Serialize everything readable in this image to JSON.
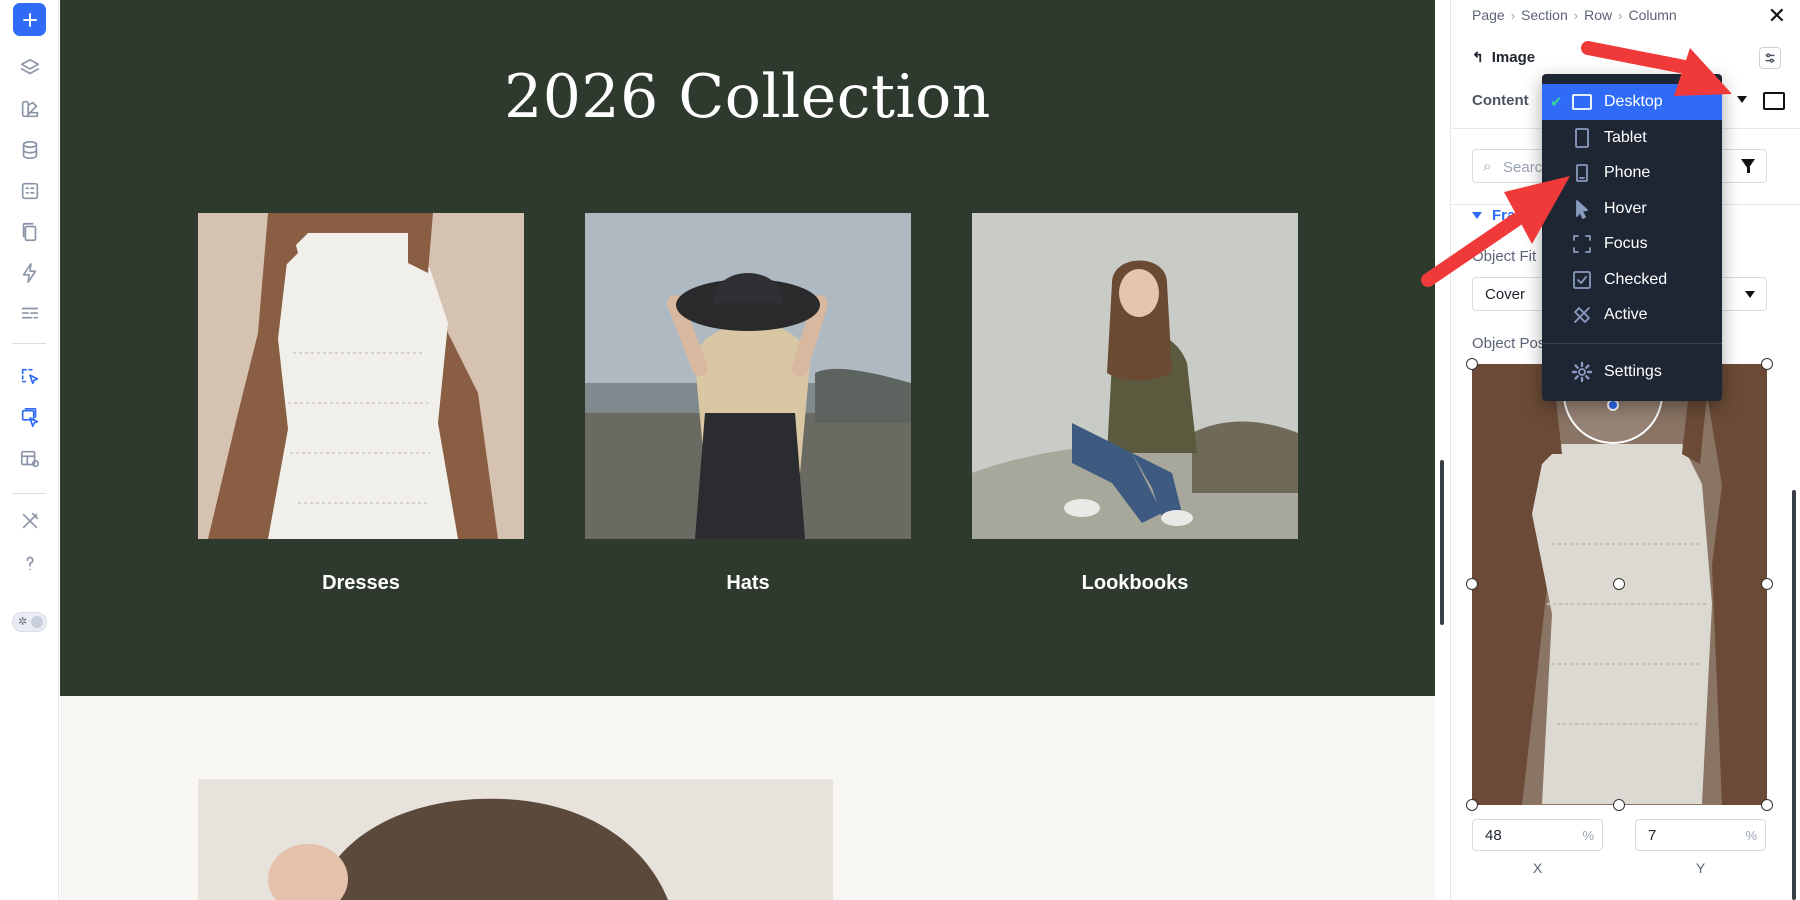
{
  "hero": {
    "title": "2026 Collection",
    "cards": [
      {
        "label": "Dresses"
      },
      {
        "label": "Hats"
      },
      {
        "label": "Lookbooks"
      }
    ]
  },
  "panel": {
    "breadcrumb": [
      "Page",
      "Section",
      "Row",
      "Column"
    ],
    "element_title": "Image",
    "content_tab": "Content",
    "search_placeholder": "Search",
    "section_title": "Frame",
    "object_fit_label": "Object Fit",
    "object_fit_value": "Cover",
    "object_position_label": "Object Position",
    "position_x": {
      "value": "48",
      "unit": "%",
      "label": "X"
    },
    "position_y": {
      "value": "7",
      "unit": "%",
      "label": "Y"
    }
  },
  "dropdown": {
    "selected": "Desktop",
    "items": [
      {
        "label": "Desktop",
        "icon": "desktop-icon"
      },
      {
        "label": "Tablet",
        "icon": "tablet-icon"
      },
      {
        "label": "Phone",
        "icon": "phone-icon"
      },
      {
        "label": "Hover",
        "icon": "cursor-icon"
      },
      {
        "label": "Focus",
        "icon": "focus-icon"
      },
      {
        "label": "Checked",
        "icon": "checkbox-icon"
      },
      {
        "label": "Active",
        "icon": "active-icon"
      }
    ],
    "settings_label": "Settings"
  },
  "colors": {
    "accent": "#2f6bf6",
    "hero_bg": "#2f3a2f",
    "dropdown_bg": "#1e2533",
    "annotation": "#f03a3a"
  }
}
